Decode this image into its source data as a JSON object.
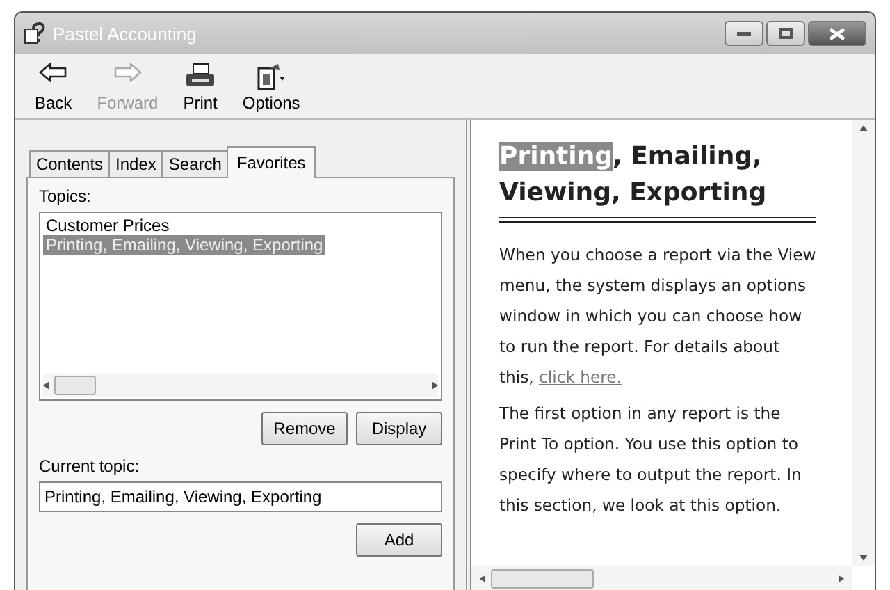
{
  "window": {
    "title": "Pastel Accounting"
  },
  "toolbar": [
    {
      "label": "Back",
      "kind": "back",
      "disabled": false
    },
    {
      "label": "Forward",
      "kind": "forward",
      "disabled": true
    },
    {
      "label": "Print",
      "kind": "print",
      "disabled": false
    },
    {
      "label": "Options",
      "kind": "options",
      "disabled": false
    }
  ],
  "tabs": [
    {
      "label": "Contents",
      "selected": false
    },
    {
      "label": "Index",
      "selected": false
    },
    {
      "label": "Search",
      "selected": false
    },
    {
      "label": "Favorites",
      "selected": true
    }
  ],
  "topics": {
    "label": "Topics:",
    "items": [
      {
        "text": "Customer Prices",
        "selected": false
      },
      {
        "text": "Printing, Emailing, Viewing, Exporting",
        "selected": true
      }
    ]
  },
  "list_buttons": [
    "Remove",
    "Display"
  ],
  "current_topic": {
    "label": "Current topic:",
    "value": "Printing, Emailing, Viewing, Exporting"
  },
  "add_button": "Add",
  "article": {
    "heading": [
      {
        "text": "Printing",
        "highlighted": true
      },
      {
        "text": ", Emailing, Viewing, Exporting",
        "highlighted": false
      }
    ],
    "paragraphs": [
      {
        "text": "When you choose a report via the View menu, the system displays an options window in which you can choose how to run the report. For details about this, ",
        "link": "click here."
      },
      {
        "text": "The first option in any report is the Print To option. You use this option to specify where to output the report. In this section, we look at this option."
      }
    ]
  }
}
